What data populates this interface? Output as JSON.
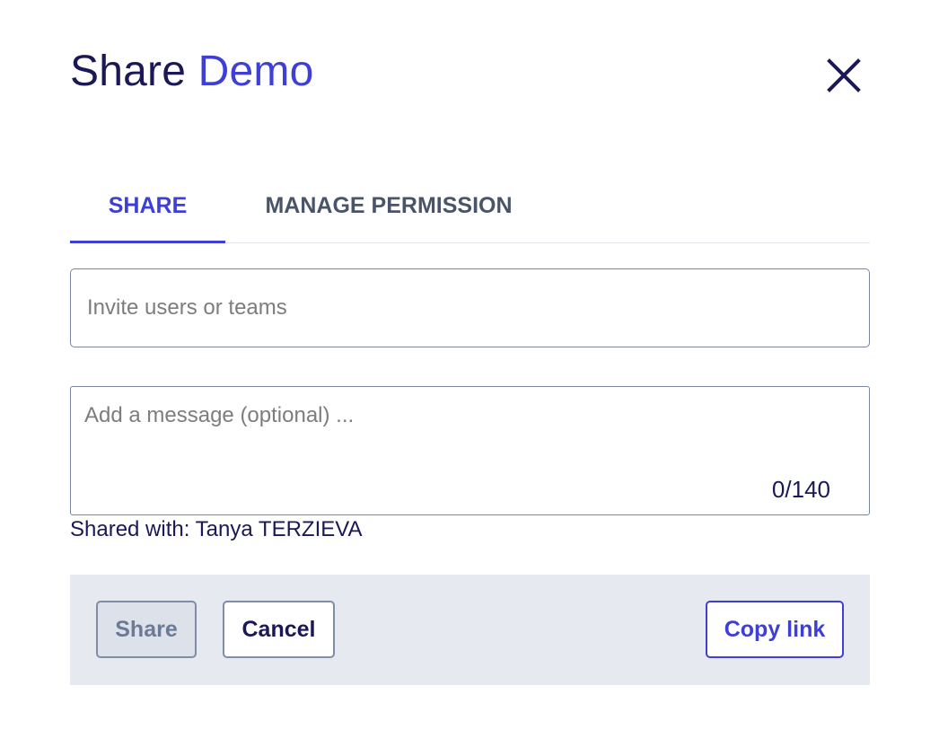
{
  "dialog": {
    "title_prefix": "Share",
    "title_name": "Demo"
  },
  "tabs": [
    {
      "label": "SHARE",
      "active": true
    },
    {
      "label": "MANAGE PERMISSION",
      "active": false
    }
  ],
  "invite": {
    "placeholder": "Invite users or teams",
    "value": ""
  },
  "message": {
    "placeholder": "Add a message (optional) ...",
    "value": "",
    "counter": "0/140"
  },
  "shared_with": "Shared with: Tanya TERZIEVA",
  "footer": {
    "share_label": "Share",
    "cancel_label": "Cancel",
    "copy_link_label": "Copy link"
  },
  "colors": {
    "accent": "#3d3fd6",
    "title": "#1b1858",
    "footer_bg": "#e6e9ef"
  },
  "icons": {
    "close": "close-icon"
  }
}
